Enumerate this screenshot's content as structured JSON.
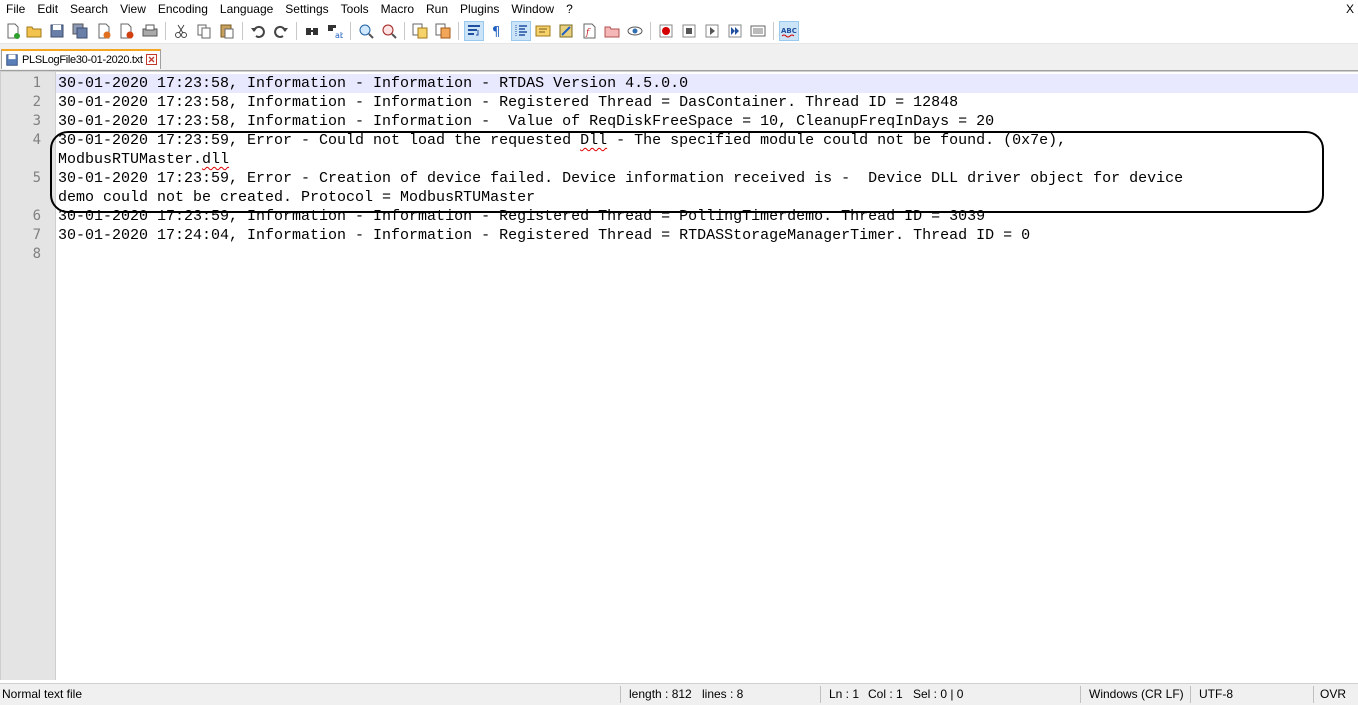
{
  "menu": {
    "items": [
      "File",
      "Edit",
      "Search",
      "View",
      "Encoding",
      "Language",
      "Settings",
      "Tools",
      "Macro",
      "Run",
      "Plugins",
      "Window",
      "?"
    ],
    "close_label": "X"
  },
  "toolbar": {
    "buttons": [
      "new-file",
      "open-file",
      "save",
      "save-all",
      "close",
      "close-all",
      "print",
      "cut",
      "copy",
      "paste",
      "undo",
      "redo",
      "find",
      "replace",
      "zoom-in",
      "zoom-out",
      "sync-vertical",
      "sync-horizontal",
      "word-wrap",
      "show-all-characters",
      "indent-guide",
      "user-defined-language",
      "document-map",
      "function-list",
      "folder-as-workspace",
      "monitoring",
      "start-recording",
      "stop-recording",
      "playback",
      "run-macro-multiple",
      "save-macro",
      "spell-check"
    ],
    "spell_check_label": "ABC",
    "colors": {
      "accent_active": "#cce4f7",
      "record_red": "#d40000"
    }
  },
  "tab": {
    "filename": "PLSLogFile30-01-2020.txt",
    "colors": {
      "top_border": "#f5a623"
    }
  },
  "editor": {
    "line_numbers": [
      "1",
      "2",
      "3",
      "4",
      "",
      "5",
      "",
      "6",
      "7",
      "8"
    ],
    "lines": [
      "30-01-2020 17:23:58, Information - Information - RTDAS Version 4.5.0.0",
      "30-01-2020 17:23:58, Information - Information - Registered Thread = DasContainer. Thread ID = 12848",
      "30-01-2020 17:23:58, Information - Information -  Value of ReqDiskFreeSpace = 10, CleanupFreqInDays = 20",
      "30-01-2020 17:23:59, Error - Could not load the requested ",
      "ModbusRTUMaster.",
      "30-01-2020 17:23:59, Error - Creation of device failed. Device information received is -  Device DLL driver object for device",
      "demo could not be created. Protocol = ModbusRTUMaster",
      "30-01-2020 17:23:59, Information - Information - Registered Thread = PollingTimerdemo. Thread ID = 3039",
      "30-01-2020 17:24:04, Information - Information - Registered Thread = RTDASStorageManagerTimer. Thread ID = 0",
      ""
    ],
    "line4_misspelled": "Dll",
    "line4_rest": " - The specified module could not be found. (0x7e),",
    "line4b_misspelled": "dll",
    "colors": {
      "current_line": "#e8e8ff",
      "gutter": "#e4e4e4",
      "spell_error": "#e00000"
    }
  },
  "status": {
    "file_type": "Normal text file",
    "length": "length : 812",
    "lines": "lines : 8",
    "ln": "Ln : 1",
    "col": "Col : 1",
    "sel": "Sel : 0 | 0",
    "eol": "Windows (CR LF)",
    "encoding": "UTF-8",
    "mode": "OVR"
  }
}
